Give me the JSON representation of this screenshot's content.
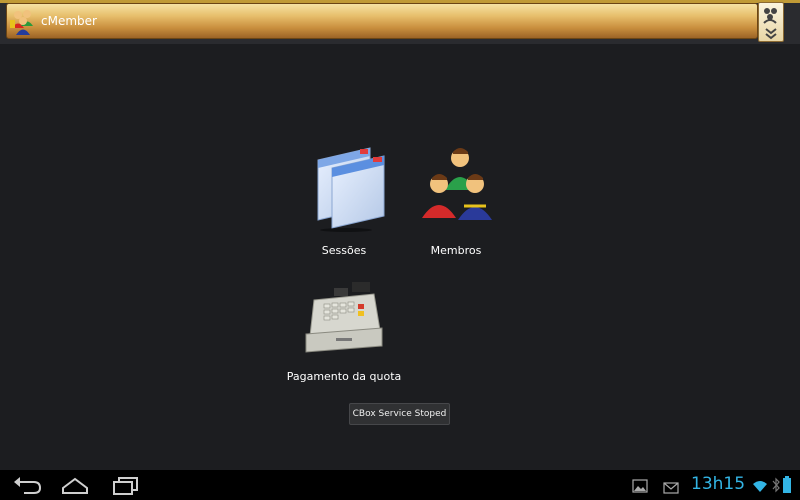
{
  "app": {
    "title": "cMember"
  },
  "tiles": [
    {
      "label": "Sessões"
    },
    {
      "label": "Membros"
    },
    {
      "label": "Pagamento da quota"
    }
  ],
  "toast": {
    "text": "CBox Service Stoped"
  },
  "statusbar": {
    "time": "13h15"
  },
  "colors": {
    "accent": "#33b5e5",
    "titlebar": "#e7bf6c",
    "background": "#1c1d20"
  }
}
